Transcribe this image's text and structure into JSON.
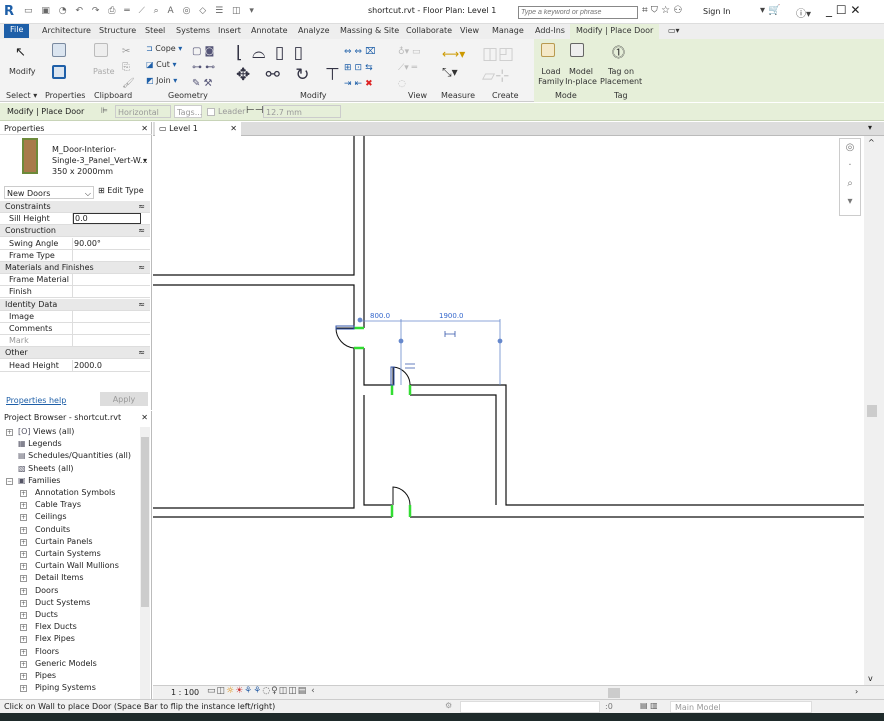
{
  "title": {
    "app_icon": "revit-logo",
    "text": "shortcut.rvt - Floor Plan: Level 1",
    "search_placeholder": "Type a keyword or phrase",
    "sign_in": "Sign In"
  },
  "tabs": [
    "File",
    "Architecture",
    "Structure",
    "Steel",
    "Systems",
    "Insert",
    "Annotate",
    "Analyze",
    "Massing & Site",
    "Collaborate",
    "View",
    "Manage",
    "Add-Ins",
    "Modify | Place Door"
  ],
  "ribbon": {
    "modify": "Modify",
    "paste": "Paste",
    "cope": "Cope",
    "cut": "Cut",
    "join": "Join",
    "load_family": "Load Family",
    "model_inplace": "Model In-place",
    "tag_on_placement": "Tag on Placement",
    "groups": [
      "Select ▾",
      "Properties",
      "Clipboard",
      "Geometry",
      "Modify",
      "View",
      "Measure",
      "Create",
      "Mode",
      "Tag"
    ]
  },
  "optionsbar": {
    "context": "Modify | Place Door",
    "orientation": "Horizontal",
    "tags": "Tags...",
    "leader": "Leader",
    "leader_checked": false,
    "length": "12.7 mm"
  },
  "properties": {
    "title": "Properties",
    "type_line1": "M_Door-Interior-",
    "type_line2": "Single-3_Panel_Vert-W...",
    "type_line3": "350 x 2000mm",
    "filter": "New Doors",
    "edit_type": "Edit Type",
    "rows": [
      {
        "section": "Constraints"
      },
      {
        "key": "Sill Height",
        "value": "0.0"
      },
      {
        "section": "Construction"
      },
      {
        "key": "Swing Angle",
        "value": "90.00°"
      },
      {
        "key": "Frame Type",
        "value": ""
      },
      {
        "section": "Materials and Finishes"
      },
      {
        "key": "Frame Material",
        "value": ""
      },
      {
        "key": "Finish",
        "value": ""
      },
      {
        "section": "Identity Data"
      },
      {
        "key": "Image",
        "value": ""
      },
      {
        "key": "Comments",
        "value": ""
      },
      {
        "key": "Mark",
        "value": ""
      },
      {
        "section": "Other"
      },
      {
        "key": "Head Height",
        "value": "2000.0"
      }
    ],
    "help": "Properties help",
    "apply": "Apply"
  },
  "browser": {
    "title": "Project Browser - shortcut.rvt",
    "top": [
      "Views (all)",
      "Legends",
      "Schedules/Quantities (all)",
      "Sheets (all)",
      "Families"
    ],
    "families": [
      "Annotation Symbols",
      "Cable Trays",
      "Ceilings",
      "Conduits",
      "Curtain Panels",
      "Curtain Systems",
      "Curtain Wall Mullions",
      "Detail Items",
      "Doors",
      "Duct Systems",
      "Ducts",
      "Flex Ducts",
      "Flex Pipes",
      "Floors",
      "Generic Models",
      "Pipes",
      "Piping Systems"
    ]
  },
  "view": {
    "tab": "Level 1",
    "dim1": "800.0",
    "dim2": "1900.0",
    "scale": "1 : 100"
  },
  "status": {
    "message": "Click on Wall to place Door (Space Bar to flip the instance left/right)",
    "count": ":0",
    "model": "Main Model"
  },
  "colors": {
    "accent": "#1e5fa8",
    "option_bar": "#e6efd9",
    "host_highlight": "#33dd33",
    "dimension": "#3366cc"
  }
}
